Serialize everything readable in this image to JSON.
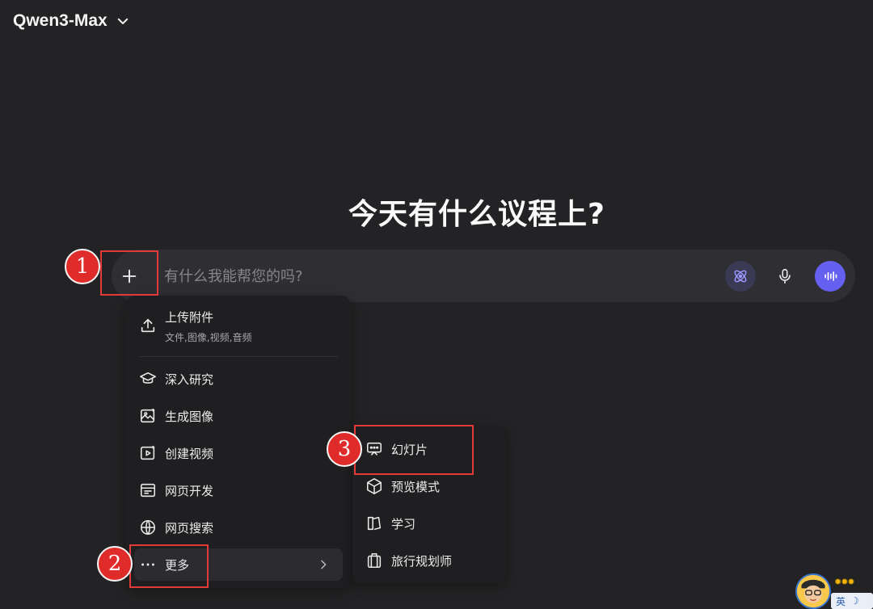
{
  "header": {
    "model_name": "Qwen3-Max"
  },
  "main": {
    "headline": "今天有什么议程上?"
  },
  "composer": {
    "placeholder": "有什么我能帮您的吗?"
  },
  "menu": {
    "upload": {
      "label": "上传附件",
      "sublabel": "文件,图像,视频,音频"
    },
    "items": [
      {
        "label": "深入研究",
        "icon": "graduation-cap-icon"
      },
      {
        "label": "生成图像",
        "icon": "image-sparkle-icon"
      },
      {
        "label": "创建视频",
        "icon": "video-play-icon"
      },
      {
        "label": "网页开发",
        "icon": "web-dev-icon"
      },
      {
        "label": "网页搜索",
        "icon": "globe-icon"
      }
    ],
    "more": {
      "label": "更多"
    }
  },
  "submenu": {
    "items": [
      {
        "label": "幻灯片",
        "icon": "slides-icon"
      },
      {
        "label": "预览模式",
        "icon": "cube-icon"
      },
      {
        "label": "学习",
        "icon": "book-icon"
      },
      {
        "label": "旅行规划师",
        "icon": "luggage-icon"
      }
    ]
  },
  "annotations": {
    "step1": "1",
    "step2": "2",
    "step3": "3"
  },
  "tray": {
    "ime_label": "英"
  },
  "colors": {
    "accent": "#6560f0",
    "annotation": "#e23a3a",
    "background": "#232325"
  }
}
